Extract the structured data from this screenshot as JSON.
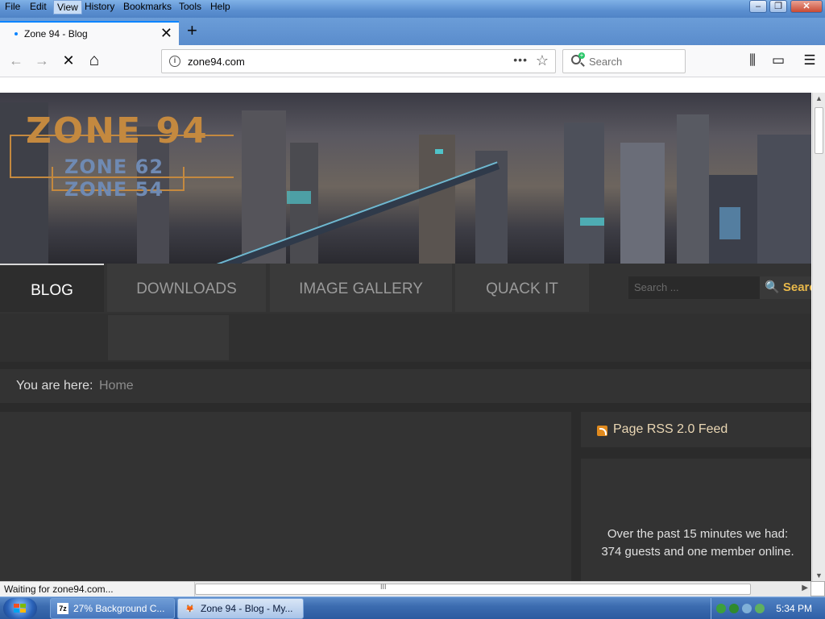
{
  "menubar": {
    "items": [
      "File",
      "Edit",
      "View",
      "History",
      "Bookmarks",
      "Tools",
      "Help"
    ]
  },
  "tab": {
    "title": "Zone 94 - Blog",
    "close": "✕"
  },
  "newtab": "+",
  "navbar": {
    "back_icon": "←",
    "forward_icon": "→",
    "stop_icon": "✕",
    "home_icon": "⌂",
    "url": "zone94.com",
    "page_actions": "•••",
    "bookmark_icon": "☆",
    "search_placeholder": "Search",
    "library_icon": "⫼",
    "sidebar_icon": "▭",
    "menu_icon": "☰"
  },
  "site": {
    "logo_main": "ZONE 94",
    "logo_sub1": "ZONE 62",
    "logo_sub2": "ZONE 54",
    "nav": [
      "BLOG",
      "DOWNLOADS",
      "IMAGE GALLERY",
      "QUACK IT"
    ],
    "search_placeholder": "Search ...",
    "search_button": "🔍 Search",
    "breadcrumb_label": "You are here:",
    "breadcrumb_home": "Home",
    "rss_label": "Page RSS 2.0 Feed",
    "online_text": "Over the past 15 minutes we had: 374 guests and one member online."
  },
  "status": {
    "text": "Waiting for zone94.com..."
  },
  "taskbar": {
    "items": [
      {
        "label": "27% Background C...",
        "icon": "7z",
        "active": false
      },
      {
        "label": "Zone 94 - Blog - My...",
        "icon": "🦊",
        "active": true
      }
    ],
    "clock": "5:34 PM"
  },
  "colors": {
    "accent": "#0a84ff",
    "site_link": "#e8b84a",
    "logo_gold": "#c4893f",
    "logo_blue": "#6f8ab3"
  }
}
